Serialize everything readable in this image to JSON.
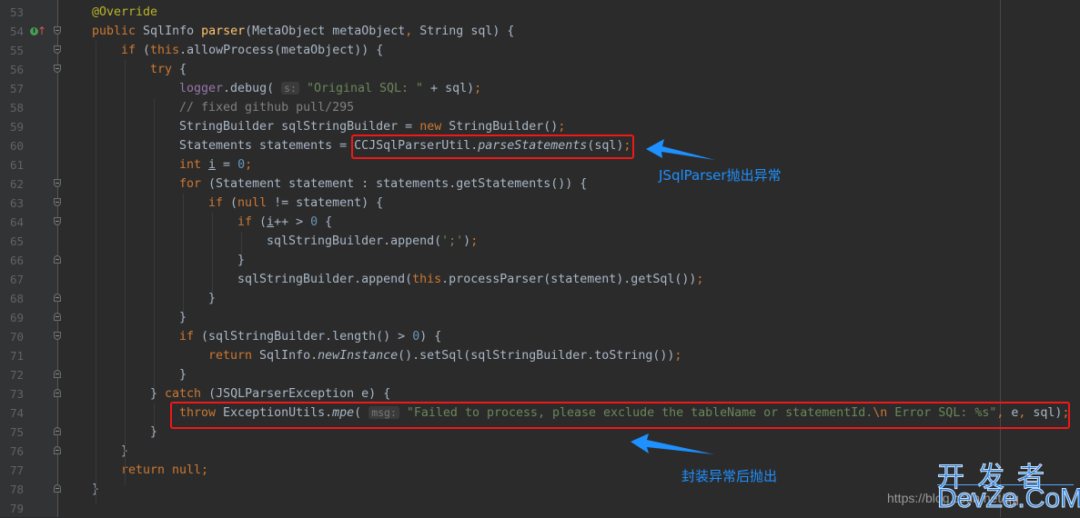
{
  "editor": {
    "lines": [
      {
        "n": "53",
        "tokens": [
          [
            "ann",
            "@Override"
          ]
        ]
      },
      {
        "n": "54",
        "tokens": [
          [
            "kw",
            "public "
          ],
          [
            "",
            "SqlInfo "
          ],
          [
            "fn",
            "parser"
          ],
          [
            "",
            "(MetaObject metaObject"
          ],
          [
            "kw",
            ", "
          ],
          [
            "",
            "String sql) {"
          ]
        ]
      },
      {
        "n": "55",
        "tokens": [
          [
            "kw",
            "if "
          ],
          [
            "",
            "("
          ],
          [
            "kw",
            "this"
          ],
          [
            "",
            ".allowProcess(metaObject)) {"
          ]
        ]
      },
      {
        "n": "56",
        "tokens": [
          [
            "kw",
            "try "
          ],
          [
            "",
            "{"
          ]
        ]
      },
      {
        "n": "57",
        "tokens": [
          [
            "fld",
            "logger"
          ],
          [
            "",
            ".debug( "
          ],
          [
            "hint",
            "s:"
          ],
          [
            "str",
            " \"Original SQL: \""
          ],
          [
            "",
            " + sql)"
          ],
          [
            "kw",
            ";"
          ]
        ]
      },
      {
        "n": "58",
        "tokens": [
          [
            "cmt",
            "// fixed github pull/295"
          ]
        ]
      },
      {
        "n": "59",
        "tokens": [
          [
            "",
            "StringBuilder sqlStringBuilder = "
          ],
          [
            "kw",
            "new "
          ],
          [
            "",
            "StringBuilder()"
          ],
          [
            "kw",
            ";"
          ]
        ]
      },
      {
        "n": "60",
        "tokens": [
          [
            "",
            "Statements statements = CCJSqlParserUtil."
          ],
          [
            "it",
            "parseStatements"
          ],
          [
            "",
            "(sql)"
          ],
          [
            "kw",
            ";"
          ]
        ]
      },
      {
        "n": "61",
        "tokens": [
          [
            "kw",
            "int "
          ],
          [
            "ul",
            "i"
          ],
          [
            "",
            " = "
          ],
          [
            "num",
            "0"
          ],
          [
            "kw",
            ";"
          ]
        ]
      },
      {
        "n": "62",
        "tokens": [
          [
            "kw",
            "for "
          ],
          [
            "",
            "(Statement statement : statements.getStatements()) {"
          ]
        ]
      },
      {
        "n": "63",
        "tokens": [
          [
            "kw",
            "if "
          ],
          [
            "",
            "("
          ],
          [
            "kw",
            "null "
          ],
          [
            "",
            "!= statement) {"
          ]
        ]
      },
      {
        "n": "64",
        "tokens": [
          [
            "kw",
            "if "
          ],
          [
            "",
            "("
          ],
          [
            "ul",
            "i"
          ],
          [
            "",
            "++ > "
          ],
          [
            "num",
            "0"
          ],
          [
            "",
            " {"
          ]
        ]
      },
      {
        "n": "65",
        "tokens": [
          [
            "",
            "sqlStringBuilder.append("
          ],
          [
            "str",
            "';'"
          ],
          [
            "",
            ")"
          ],
          [
            "kw",
            ";"
          ]
        ]
      },
      {
        "n": "66",
        "tokens": [
          [
            "",
            "}"
          ]
        ]
      },
      {
        "n": "67",
        "tokens": [
          [
            "",
            "sqlStringBuilder.append("
          ],
          [
            "kw",
            "this"
          ],
          [
            "",
            ".processParser(statement).getSql())"
          ],
          [
            "kw",
            ";"
          ]
        ]
      },
      {
        "n": "68",
        "tokens": [
          [
            "",
            "}"
          ]
        ]
      },
      {
        "n": "69",
        "tokens": [
          [
            "",
            "}"
          ]
        ]
      },
      {
        "n": "70",
        "tokens": [
          [
            "kw",
            "if "
          ],
          [
            "",
            "(sqlStringBuilder.length() > "
          ],
          [
            "num",
            "0"
          ],
          [
            "",
            ") {"
          ]
        ]
      },
      {
        "n": "71",
        "tokens": [
          [
            "kw",
            "return "
          ],
          [
            "",
            "SqlInfo."
          ],
          [
            "it",
            "newInstance"
          ],
          [
            "",
            "().setSql(sqlStringBuilder.toString())"
          ],
          [
            "kw",
            ";"
          ]
        ]
      },
      {
        "n": "72",
        "tokens": [
          [
            "",
            "}"
          ]
        ]
      },
      {
        "n": "73",
        "tokens": [
          [
            "",
            "} "
          ],
          [
            "kw",
            "catch "
          ],
          [
            "",
            "(JSQLParserException e) {"
          ]
        ]
      },
      {
        "n": "74",
        "tokens": [
          [
            "kw",
            "throw "
          ],
          [
            "",
            "ExceptionUtils."
          ],
          [
            "it",
            "mpe"
          ],
          [
            "",
            "( "
          ],
          [
            "hint",
            "msg:"
          ],
          [
            "str",
            " \"Failed to process, please exclude the tableName or statementId."
          ],
          [
            "esc",
            "\\n"
          ],
          [
            "str",
            " Error SQL: %s\""
          ],
          [
            "kw",
            ", "
          ],
          [
            "",
            "e"
          ],
          [
            "kw",
            ", "
          ],
          [
            "",
            "sql)"
          ],
          [
            "kw",
            ";"
          ]
        ]
      },
      {
        "n": "75",
        "tokens": [
          [
            "",
            "}"
          ]
        ]
      },
      {
        "n": "76",
        "tokens": [
          [
            "",
            "}"
          ]
        ]
      },
      {
        "n": "77",
        "tokens": [
          [
            "kw",
            "return null;"
          ]
        ]
      },
      {
        "n": "78",
        "tokens": [
          [
            "",
            "}"
          ]
        ]
      },
      {
        "n": "79",
        "tokens": []
      }
    ]
  },
  "annotations": {
    "parse_error": "JSqlParser抛出异常",
    "wrap_rethrow": "封装异常后抛出"
  },
  "watermark": {
    "url": "https://blog.csdn.net/qq",
    "brand_cn": "开发者",
    "brand_en": "DevZe.CoM"
  },
  "colors": {
    "background": "#2b2b2b",
    "highlight_box": "#f01818",
    "annotation": "#1e90ff"
  }
}
